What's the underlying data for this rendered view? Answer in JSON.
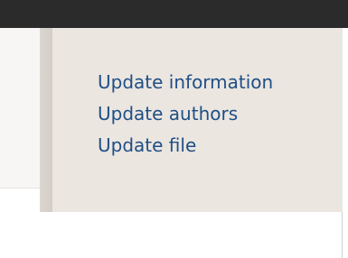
{
  "menu": {
    "items": [
      {
        "label": "Update information"
      },
      {
        "label": "Update authors"
      },
      {
        "label": "Update file"
      }
    ]
  },
  "colors": {
    "top_bar": "#2b2b2b",
    "panel_background": "#ebe6e0",
    "link": "#1f4f86"
  }
}
